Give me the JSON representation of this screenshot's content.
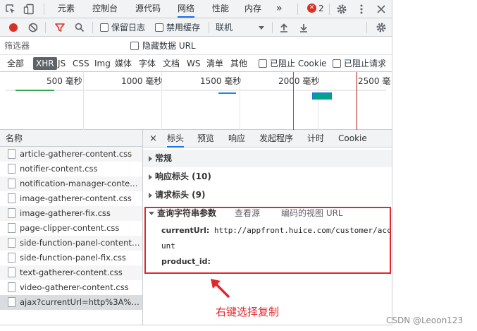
{
  "tabs": {
    "elements": "元素",
    "console": "控制台",
    "sources": "源代码",
    "network": "网络",
    "performance": "性能",
    "memory": "内存",
    "more": "»",
    "error_count": "2"
  },
  "toolbar": {
    "preserve_log": "保留日志",
    "disable_cache": "禁用缓存",
    "throttling": "联机"
  },
  "filter": {
    "placeholder": "筛选器",
    "hide_data_urls": "隐藏数据 URL"
  },
  "types": {
    "all": "全部",
    "xhr": "XHR",
    "js": "JS",
    "css": "CSS",
    "img": "Img",
    "media": "媒体",
    "font": "字体",
    "doc": "文档",
    "ws": "WS",
    "manifest": "清单",
    "other": "其他",
    "blocked_cookies": "已阻止 Cookie",
    "blocked_requests": "已阻止请求"
  },
  "overview": {
    "ticks": [
      "500 毫秒",
      "1000 毫秒",
      "1500 毫秒",
      "2000 毫秒",
      "2500 毫"
    ]
  },
  "requests": {
    "header": "名称",
    "items": [
      "article-gatherer-content.css",
      "notifier-content.css",
      "notification-manager-content...",
      "image-gatherer-content.css",
      "image-gatherer-fix.css",
      "page-clipper-content.css",
      "side-function-panel-content.css",
      "side-function-panel-fix.css",
      "text-gatherer-content.css",
      "video-gatherer-content.css",
      "ajax?currentUrl=http%3A%2F..."
    ]
  },
  "detail": {
    "close": "×",
    "tabs": [
      "标头",
      "预览",
      "响应",
      "发起程序",
      "计时",
      "Cookie"
    ],
    "general": "常规",
    "response_headers": "响应标头 (10)",
    "request_headers": "请求标头 (9)",
    "query_string": "查询字符串参数",
    "view_source": "查看源",
    "view_url_encoded": "编码的视图 URL",
    "param1_key": "currentUrl:",
    "param1_value": "http://appfront.huice.com/customer/acco",
    "param1_cont": "unt",
    "param2_key": "product_id:"
  },
  "annotation": "右键选择复制",
  "watermark": "CSDN @Leoon123",
  "colors": {
    "accent": "#1a73e8",
    "record": "#d93025",
    "highlight_box": "#e0282d"
  }
}
